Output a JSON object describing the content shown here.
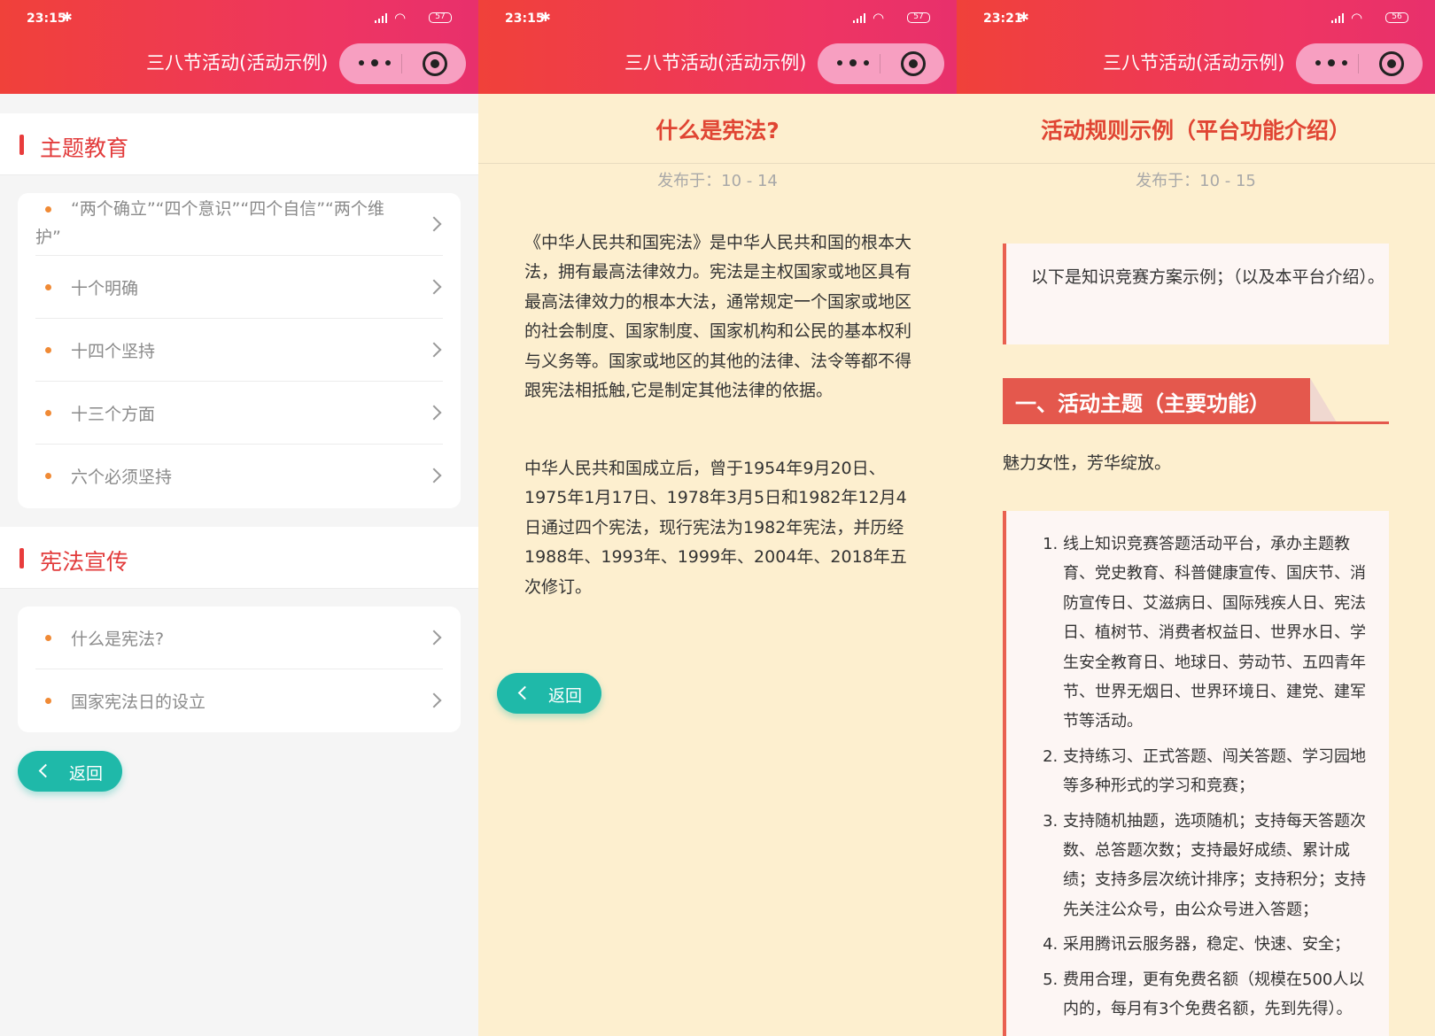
{
  "panels": [
    {
      "status": {
        "time": "23:15",
        "battery": "57"
      },
      "nav_title": "三八节活动(活动示例)",
      "sections": [
        {
          "title": "主题教育",
          "items": [
            "“两个确立”“四个意识”“四个自信”“两个维护”",
            "十个明确",
            "十四个坚持",
            "十三个方面",
            "六个必须坚持"
          ]
        },
        {
          "title": "宪法宣传",
          "items": [
            "什么是宪法?",
            "国家宪法日的设立"
          ]
        }
      ],
      "back_label": "返回"
    },
    {
      "status": {
        "time": "23:15",
        "battery": "57"
      },
      "nav_title": "三八节活动(活动示例)",
      "article_title": "什么是宪法?",
      "published": "发布于：10 - 14",
      "paragraphs": [
        "《中华人民共和国宪法》是中华人民共和国的根本大法，拥有最高法律效力。宪法是主权国家或地区具有最高法律效力的根本大法，通常规定一个国家或地区的社会制度、国家制度、国家机构和公民的基本权利与义务等。国家或地区的其他的法律、法令等都不得跟宪法相抵触,它是制定其他法律的依据。",
        "中华人民共和国成立后，曾于1954年9月20日、1975年1月17日、1978年3月5日和1982年12月4日通过四个宪法，现行宪法为1982年宪法，并历经1988年、1993年、1999年、2004年、2018年五次修订。"
      ],
      "back_label": "返回"
    },
    {
      "status": {
        "time": "23:21",
        "battery": "56"
      },
      "nav_title": "三八节活动(活动示例)",
      "article_title": "活动规则示例（平台功能介绍）",
      "published": "发布于：10 - 15",
      "quote": "以下是知识竞赛方案示例；（以及本平台介绍）。",
      "banner": "一、活动主题（主要功能）",
      "theme_text": "魅力女性，芳华绽放。",
      "list": [
        "线上知识竞赛答题活动平台，承办主题教育、党史教育、科普健康宣传、国庆节、消防宣传日、艾滋病日、国际残疾人日、宪法日、植树节、消费者权益日、世界水日、学生安全教育日、地球日、劳动节、五四青年节、世界无烟日、世界环境日、建党、建军节等活动。",
        "支持练习、正式答题、闯关答题、学习园地等多种形式的学习和竞赛；",
        "支持随机抽题，选项随机；支持每天答题次数、总答题次数；支持最好成绩、累计成绩；支持多层次统计排序；支持积分；支持先关注公众号，由公众号进入答题；",
        "采用腾讯云服务器，稳定、快速、安全；",
        "费用合理，更有免费名额（规模在500人以内的，每月有3个免费名额，先到先得）。"
      ]
    }
  ],
  "icons": {
    "bluetooth": "bluetooth-icon",
    "signal": "signal-icon",
    "wifi": "wifi-icon",
    "battery": "battery-icon",
    "more": "more-dots-icon",
    "close": "record-close-icon",
    "chevron": "chevron-right-icon",
    "back": "chevron-left-icon"
  },
  "colors": {
    "header_start": "#f0413a",
    "header_end": "#e8306c",
    "accent_red": "#e23b3b",
    "bullet_orange": "#f08a35",
    "back_button": "#1fb9a9",
    "article_bg": "#fdefcf"
  }
}
